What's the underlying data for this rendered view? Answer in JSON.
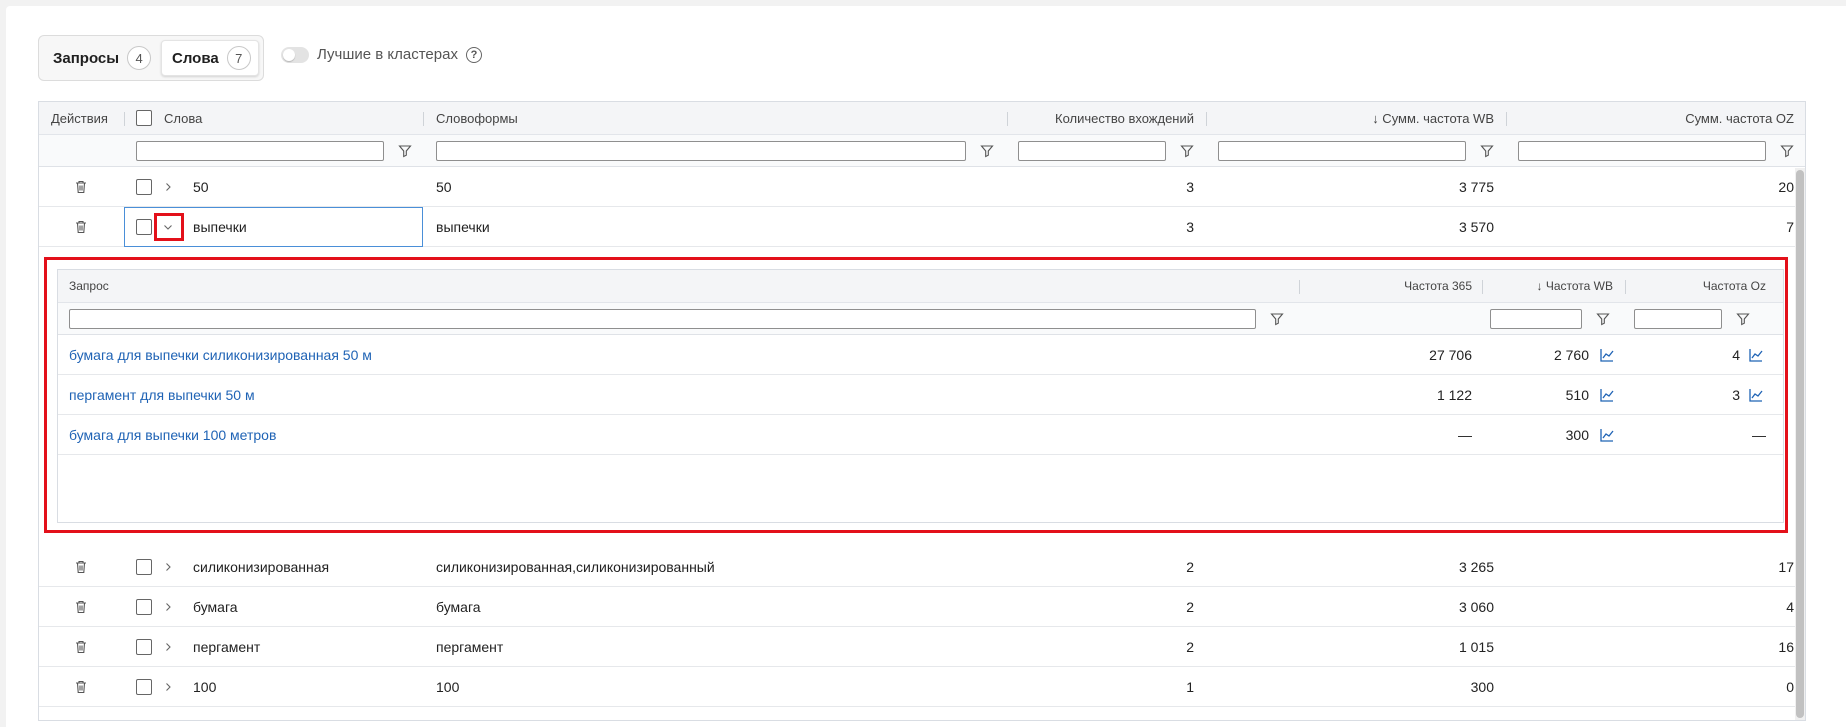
{
  "tabs": [
    {
      "label": "Запросы",
      "count": "4"
    },
    {
      "label": "Слова",
      "count": "7"
    }
  ],
  "toggle": {
    "label": "Лучшие в кластерах"
  },
  "columns": {
    "actions": "Действия",
    "words": "Слова",
    "wordforms": "Словоформы",
    "occurrences": "Количество вхождений",
    "sum_wb": "↓ Сумм. частота WB",
    "sum_oz": "Сумм. частота OZ"
  },
  "rows": [
    {
      "word": "50",
      "forms": "50",
      "occ": "3",
      "wb": "3 775",
      "oz": "20"
    },
    {
      "word": "выпечки",
      "forms": "выпечки",
      "occ": "3",
      "wb": "3 570",
      "oz": "7"
    },
    {
      "word": "силиконизированная",
      "forms": "силиконизированная,силиконизированный",
      "occ": "2",
      "wb": "3 265",
      "oz": "17"
    },
    {
      "word": "бумага",
      "forms": "бумага",
      "occ": "2",
      "wb": "3 060",
      "oz": "4"
    },
    {
      "word": "пергамент",
      "forms": "пергамент",
      "occ": "2",
      "wb": "1 015",
      "oz": "16"
    },
    {
      "word": "100",
      "forms": "100",
      "occ": "1",
      "wb": "300",
      "oz": "0"
    }
  ],
  "nested": {
    "columns": {
      "query": "Запрос",
      "f365": "Частота 365",
      "fwb": "↓ Частота WB",
      "foz": "Частота Oz"
    },
    "rows": [
      {
        "query": "бумага для выпечки силиконизированная 50 м",
        "f365": "27 706",
        "fwb": "2 760",
        "foz": "4"
      },
      {
        "query": "пергамент для выпечки 50 м",
        "f365": "1 122",
        "fwb": "510",
        "foz": "3"
      },
      {
        "query": "бумага для выпечки 100 метров",
        "f365": "—",
        "fwb": "300",
        "foz": "—"
      }
    ]
  },
  "colors": {
    "accent": "#1f63b5",
    "highlight": "#e3101a",
    "focus": "#4a8fd8"
  }
}
